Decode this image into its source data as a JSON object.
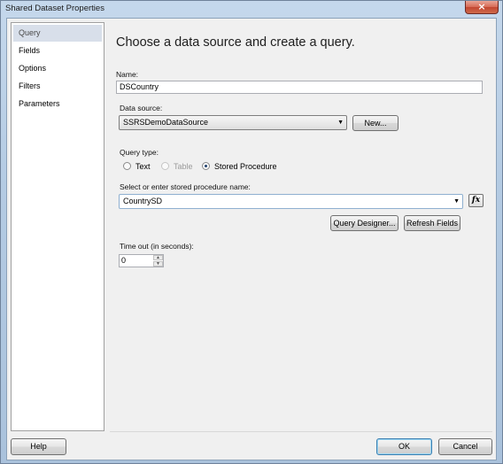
{
  "window": {
    "title": "Shared Dataset Properties",
    "close_glyph": "×"
  },
  "nav": {
    "items": [
      {
        "label": "Query",
        "selected": true
      },
      {
        "label": "Fields",
        "selected": false
      },
      {
        "label": "Options",
        "selected": false
      },
      {
        "label": "Filters",
        "selected": false
      },
      {
        "label": "Parameters",
        "selected": false
      }
    ]
  },
  "page": {
    "heading": "Choose a data source and create a query.",
    "name_label": "Name:",
    "name_value": "DSCountry",
    "datasource_label": "Data source:",
    "datasource_value": "SSRSDemoDataSource",
    "new_button": "New...",
    "query_type_label": "Query type:",
    "query_types": [
      {
        "label": "Text",
        "checked": false,
        "disabled": false
      },
      {
        "label": "Table",
        "checked": false,
        "disabled": true
      },
      {
        "label": "Stored Procedure",
        "checked": true,
        "disabled": false
      }
    ],
    "sp_label": "Select or enter stored procedure name:",
    "sp_value": "CountrySD",
    "fx_label": "fx",
    "query_designer_button": "Query Designer...",
    "refresh_fields_button": "Refresh Fields",
    "timeout_label": "Time out (in seconds):",
    "timeout_value": "0"
  },
  "footer": {
    "help_button": "Help",
    "ok_button": "OK",
    "cancel_button": "Cancel"
  },
  "icons": {
    "dropdown_arrow": "chevron-down-icon",
    "spin_up": "spin-up-icon",
    "spin_down": "spin-down-icon"
  }
}
